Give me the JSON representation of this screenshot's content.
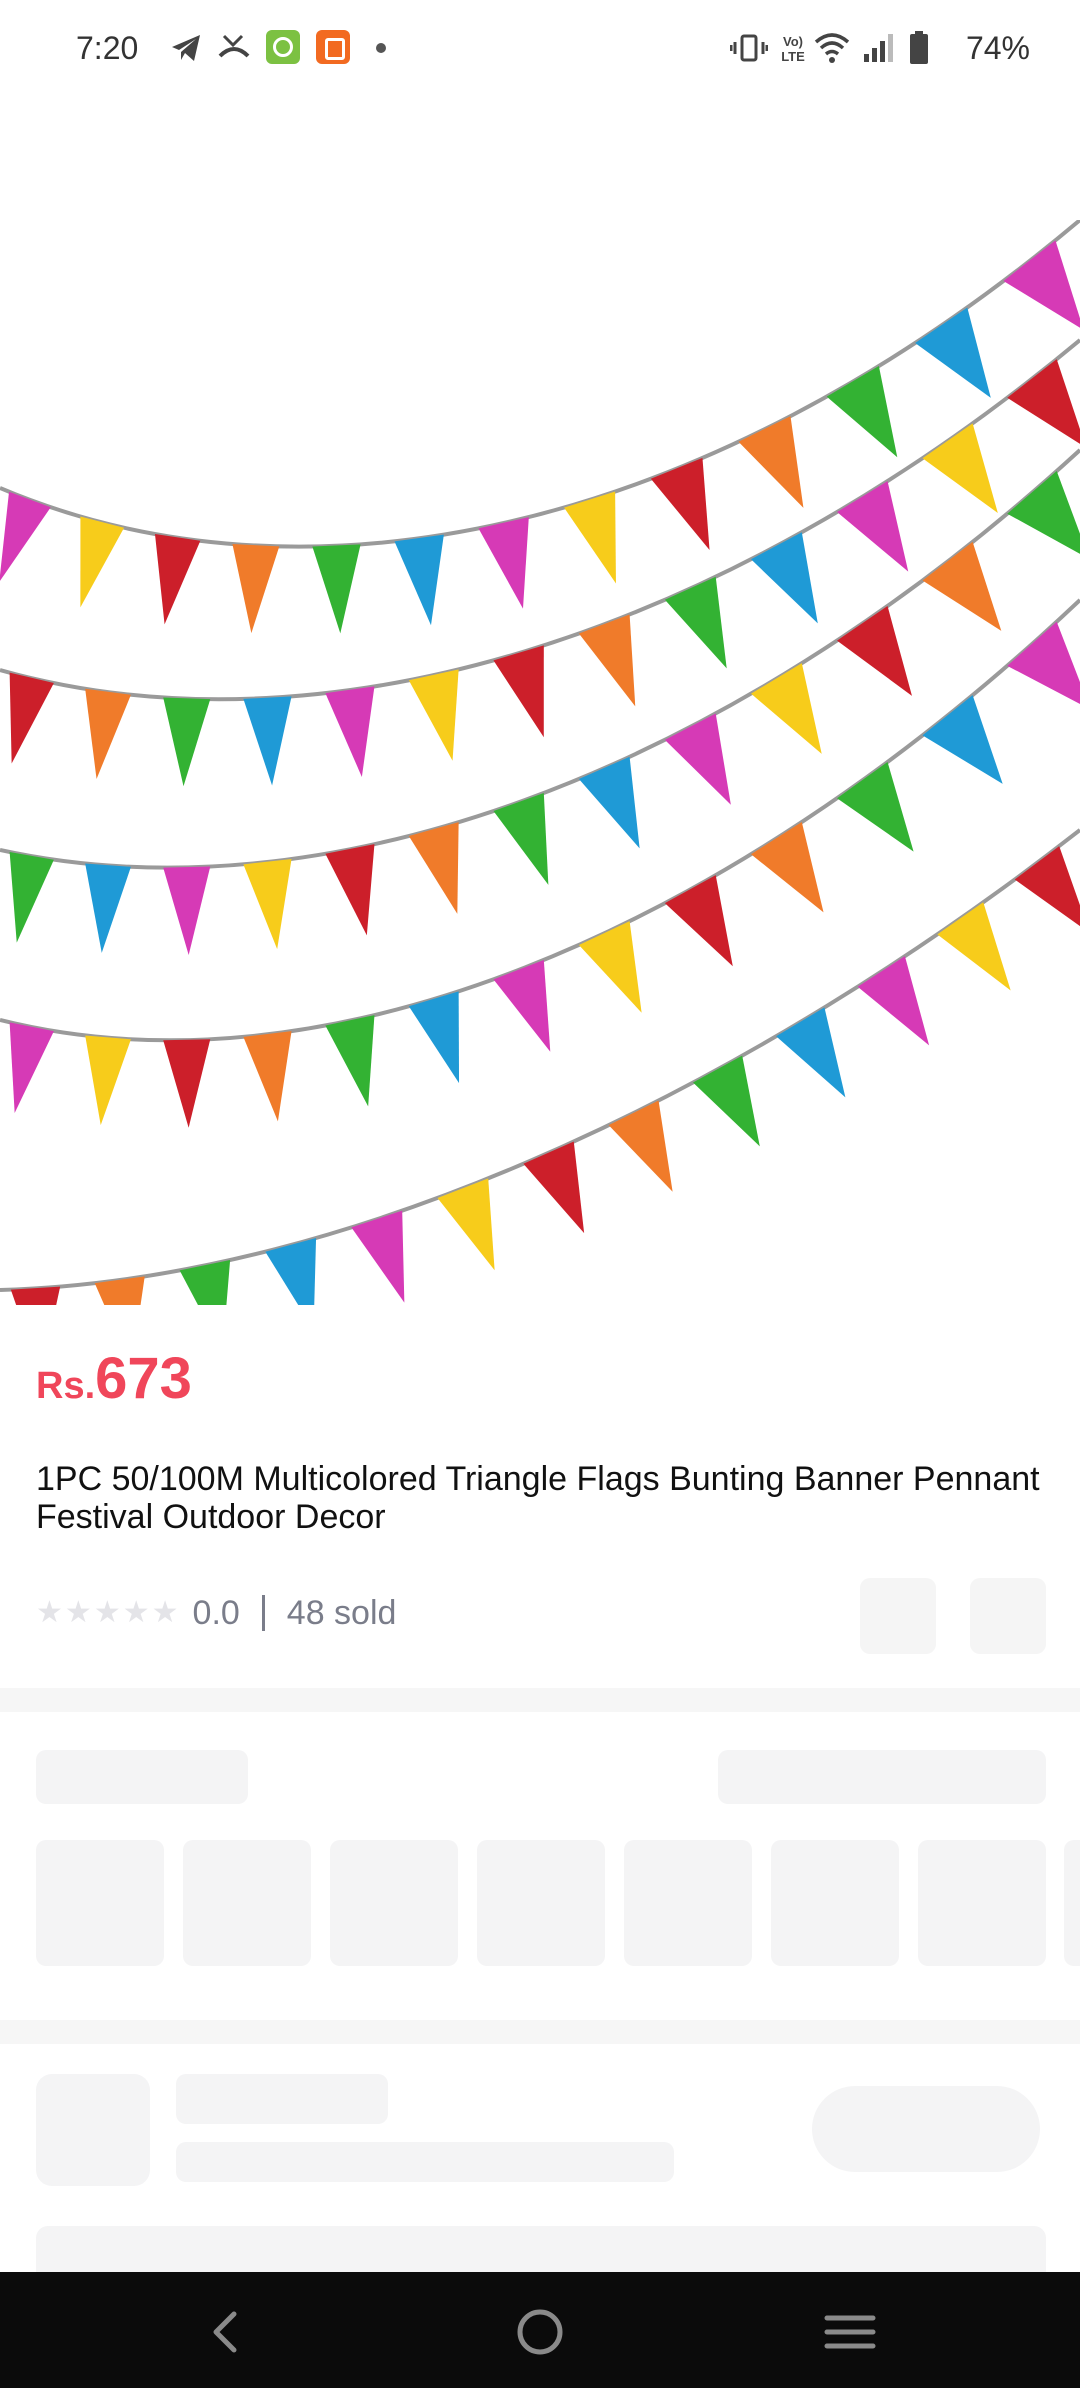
{
  "status_bar": {
    "time": "7:20",
    "battery": "74%",
    "icons": [
      "telegram-icon",
      "missed-call-icon",
      "green-app-icon",
      "orange-app-icon",
      "dot-icon",
      "vibrate-icon",
      "volte-icon",
      "wifi-icon",
      "signal-icon",
      "battery-icon"
    ]
  },
  "product": {
    "price_currency": "Rs.",
    "price_amount": "673",
    "title": "1PC 50/100M Multicolored Triangle Flags Bunting Banner Pennant Festival Outdoor Decor",
    "rating": "0.0",
    "sold": "48 sold",
    "star_count": 5
  },
  "colors": {
    "accent": "#f0465a",
    "muted_text": "#7a7d8a",
    "skeleton": "#f4f4f5",
    "nav_bg": "#0b0b0b",
    "flag_colors": [
      "#d63ab6",
      "#f7cc1b",
      "#cc1f2a",
      "#f07b2a",
      "#33b233",
      "#1f9ad6"
    ]
  },
  "nav": {
    "back_icon": "back-icon",
    "home_icon": "home-icon",
    "recents_icon": "recents-icon"
  }
}
